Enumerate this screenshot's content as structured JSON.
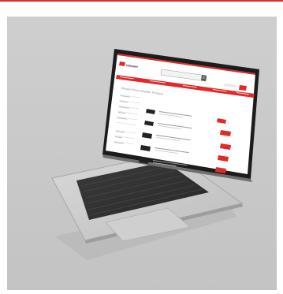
{
  "page": {
    "accent": "#e02a2a",
    "background": "#c9c9c9"
  },
  "screen": {
    "brand": "mouser",
    "brand_logo_text": "mouser",
    "nav_items": [
      "",
      "",
      "",
      "",
      ""
    ],
    "page_title": "Mouser Power Amplifier Products",
    "results": [
      {
        "title": "",
        "action": ""
      },
      {
        "title": "",
        "action": ""
      },
      {
        "title": "",
        "action": ""
      },
      {
        "title": "",
        "action": ""
      },
      {
        "title": "",
        "action": ""
      }
    ]
  },
  "icons": {
    "search": "magnifier-icon",
    "cart": "cart-icon"
  }
}
